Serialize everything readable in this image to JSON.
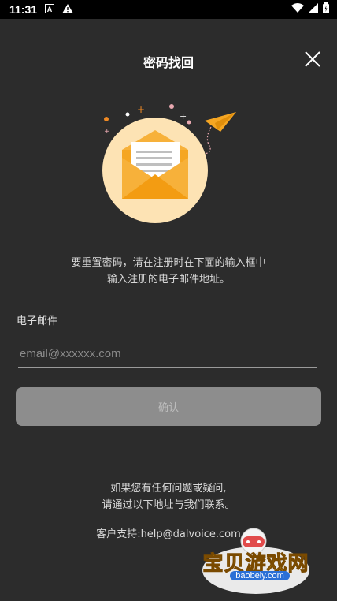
{
  "status_bar": {
    "time": "11:31",
    "icons": [
      "font-icon",
      "warning-icon",
      "wifi-icon",
      "signal-icon",
      "battery-icon"
    ]
  },
  "header": {
    "title": "密码找回",
    "close_icon": "close-icon"
  },
  "description": {
    "line1": "要重置密码，请在注册时在下面的输入框中",
    "line2": "输入注册的电子邮件地址。"
  },
  "form": {
    "email_label": "电子邮件",
    "email_placeholder": "email@xxxxxx.com",
    "email_value": "",
    "confirm_label": "确认"
  },
  "help": {
    "line1": "如果您有任何问题或疑问,",
    "line2": "请通过以下地址与我们联系。",
    "support": "客户支持:help@dalvoice.com"
  },
  "watermark": {
    "text": "宝贝游戏网",
    "url": "baobeiy.com"
  },
  "colors": {
    "background": "#2c2c2c",
    "button": "#8d8d8d",
    "accent": "#f5a623",
    "circle": "#fde3b4"
  }
}
